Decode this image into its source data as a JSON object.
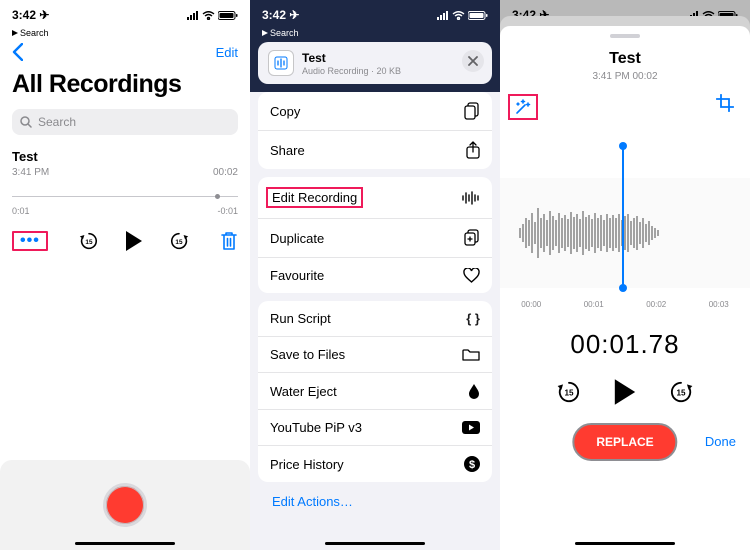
{
  "status": {
    "time": "3:42",
    "back_crumb": "Search",
    "location_arrow": "↗"
  },
  "screen1": {
    "edit": "Edit",
    "title": "All Recordings",
    "search_placeholder": "Search",
    "track": {
      "name": "Test",
      "time_label": "3:41 PM",
      "duration": "00:02",
      "elapsed": "0:01",
      "remaining": "-0:01"
    }
  },
  "screen2": {
    "header": {
      "name": "Test",
      "meta": "Audio Recording · 20 KB"
    },
    "groups": [
      {
        "items": [
          {
            "label": "Copy",
            "icon": "copy"
          },
          {
            "label": "Share",
            "icon": "share"
          }
        ]
      },
      {
        "items": [
          {
            "label": "Edit Recording",
            "icon": "waveform",
            "highlighted": true
          },
          {
            "label": "Duplicate",
            "icon": "duplicate"
          },
          {
            "label": "Favourite",
            "icon": "heart"
          }
        ]
      },
      {
        "items": [
          {
            "label": "Run Script",
            "icon": "braces"
          },
          {
            "label": "Save to Files",
            "icon": "folder"
          },
          {
            "label": "Water Eject",
            "icon": "drop"
          },
          {
            "label": "YouTube PiP v3",
            "icon": "yt"
          },
          {
            "label": "Price History",
            "icon": "dollar"
          }
        ]
      }
    ],
    "edit_actions": "Edit Actions…"
  },
  "screen3": {
    "title": "Test",
    "subtitle": "3:41 PM   00:02",
    "timeline": [
      "00:00",
      "00:01",
      "00:02",
      "00:03"
    ],
    "big_time": "00:01.78",
    "replace": "REPLACE",
    "done": "Done"
  }
}
